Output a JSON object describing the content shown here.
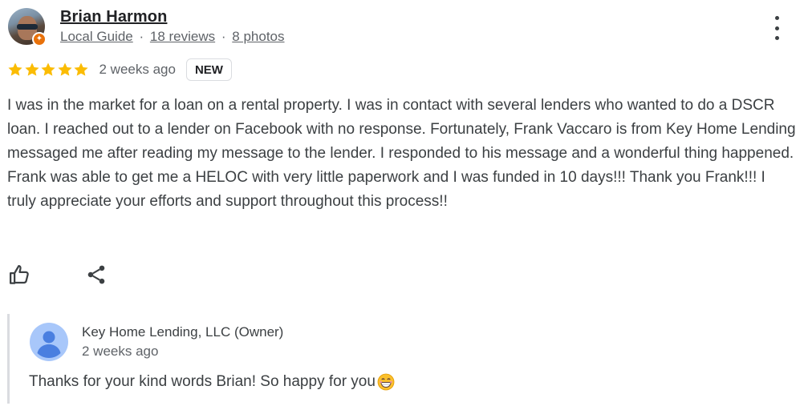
{
  "reviewer": {
    "name": "Brian Harmon",
    "badge": "Local Guide",
    "separator": "·",
    "reviews": "18 reviews",
    "photos": "8 photos"
  },
  "rating": {
    "stars": 5,
    "max_stars": 5,
    "date": "2 weeks ago",
    "badge": "NEW",
    "star_color": "#fbbc04"
  },
  "review": {
    "text": "I was in the market for a loan on a rental property. I was in contact with several lenders who wanted to do a DSCR loan. I reached out to a lender on Facebook with no response. Fortunately, Frank Vaccaro is from Key Home Lending messaged me after reading my message to the lender. I responded to his message and a wonderful thing happened. Frank was able to get me a HELOC with very little paperwork and I was funded in 10 days!!! Thank you Frank!!! I truly appreciate your efforts and support throughout this process!!"
  },
  "actions": {
    "like_icon": "thumbs-up-icon",
    "share_icon": "share-icon",
    "more_icon": "more-vert-icon"
  },
  "owner_reply": {
    "name": "Key Home Lending, LLC (Owner)",
    "date": "2 weeks ago",
    "text": "Thanks for your kind words Brian! So happy for you",
    "emoji": "grinning-face-emoji",
    "avatar_color": "#a8c7fa",
    "avatar_fg": "#4285f4"
  }
}
